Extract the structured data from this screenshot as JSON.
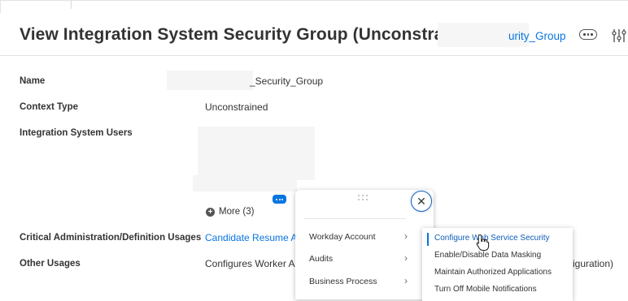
{
  "page": {
    "title": "View Integration System Security Group (Unconstrained)",
    "header_link_text": "urity_Group"
  },
  "fields": {
    "name_label": "Name",
    "name_value": "_Security_Group",
    "context_type_label": "Context Type",
    "context_type_value": "Unconstrained",
    "isu_label": "Integration System Users",
    "more_label": "More (3)",
    "critical_label": "Critical Administration/Definition Usages",
    "critical_value": "Candidate Resume At",
    "other_label": "Other Usages",
    "other_value": "Configures Worker All",
    "other_value_tail": "iguration)"
  },
  "popup": {
    "categories": [
      {
        "label": "Workday Account"
      },
      {
        "label": "Audits"
      },
      {
        "label": "Business Process"
      }
    ]
  },
  "submenu": {
    "items": [
      {
        "label": "Configure Web Service Security"
      },
      {
        "label": "Enable/Disable Data Masking"
      },
      {
        "label": "Maintain Authorized Applications"
      },
      {
        "label": "Turn Off Mobile Notifications"
      }
    ]
  },
  "icons": {
    "header_actions": "more-horizontal-icon",
    "header_config": "configure-icon",
    "related_actions": "related-actions-icon",
    "close": "close-icon",
    "chevron": "chevron-right-icon",
    "cursor": "hand-pointer-icon"
  },
  "colors": {
    "link": "#0875e1",
    "related_actions": "#0875e1",
    "close_ring": "#1a5fb4"
  }
}
